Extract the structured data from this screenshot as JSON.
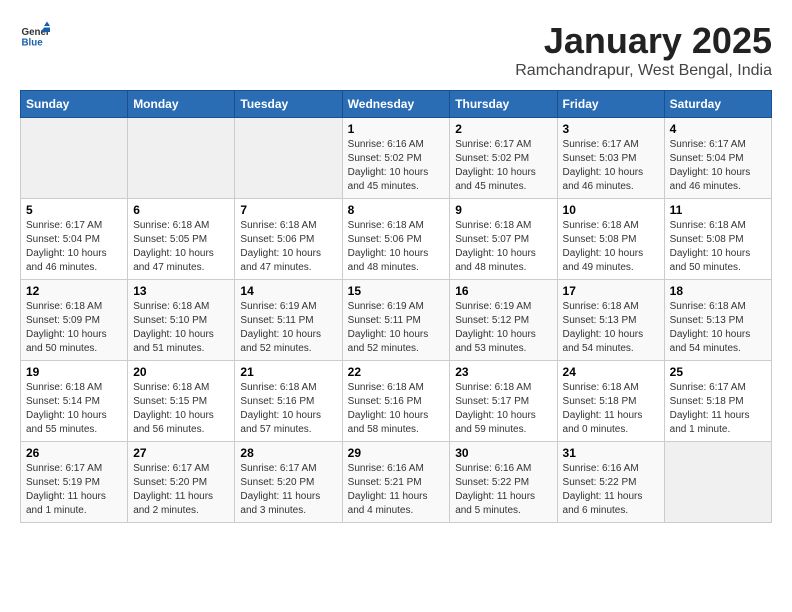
{
  "header": {
    "logo": {
      "general": "General",
      "blue": "Blue"
    },
    "title": "January 2025",
    "subtitle": "Ramchandrapur, West Bengal, India"
  },
  "days_of_week": [
    "Sunday",
    "Monday",
    "Tuesday",
    "Wednesday",
    "Thursday",
    "Friday",
    "Saturday"
  ],
  "weeks": [
    [
      {
        "day": "",
        "sunrise": "",
        "sunset": "",
        "daylight": "",
        "empty": true
      },
      {
        "day": "",
        "sunrise": "",
        "sunset": "",
        "daylight": "",
        "empty": true
      },
      {
        "day": "",
        "sunrise": "",
        "sunset": "",
        "daylight": "",
        "empty": true
      },
      {
        "day": "1",
        "sunrise": "Sunrise: 6:16 AM",
        "sunset": "Sunset: 5:02 PM",
        "daylight": "Daylight: 10 hours and 45 minutes."
      },
      {
        "day": "2",
        "sunrise": "Sunrise: 6:17 AM",
        "sunset": "Sunset: 5:02 PM",
        "daylight": "Daylight: 10 hours and 45 minutes."
      },
      {
        "day": "3",
        "sunrise": "Sunrise: 6:17 AM",
        "sunset": "Sunset: 5:03 PM",
        "daylight": "Daylight: 10 hours and 46 minutes."
      },
      {
        "day": "4",
        "sunrise": "Sunrise: 6:17 AM",
        "sunset": "Sunset: 5:04 PM",
        "daylight": "Daylight: 10 hours and 46 minutes."
      }
    ],
    [
      {
        "day": "5",
        "sunrise": "Sunrise: 6:17 AM",
        "sunset": "Sunset: 5:04 PM",
        "daylight": "Daylight: 10 hours and 46 minutes."
      },
      {
        "day": "6",
        "sunrise": "Sunrise: 6:18 AM",
        "sunset": "Sunset: 5:05 PM",
        "daylight": "Daylight: 10 hours and 47 minutes."
      },
      {
        "day": "7",
        "sunrise": "Sunrise: 6:18 AM",
        "sunset": "Sunset: 5:06 PM",
        "daylight": "Daylight: 10 hours and 47 minutes."
      },
      {
        "day": "8",
        "sunrise": "Sunrise: 6:18 AM",
        "sunset": "Sunset: 5:06 PM",
        "daylight": "Daylight: 10 hours and 48 minutes."
      },
      {
        "day": "9",
        "sunrise": "Sunrise: 6:18 AM",
        "sunset": "Sunset: 5:07 PM",
        "daylight": "Daylight: 10 hours and 48 minutes."
      },
      {
        "day": "10",
        "sunrise": "Sunrise: 6:18 AM",
        "sunset": "Sunset: 5:08 PM",
        "daylight": "Daylight: 10 hours and 49 minutes."
      },
      {
        "day": "11",
        "sunrise": "Sunrise: 6:18 AM",
        "sunset": "Sunset: 5:08 PM",
        "daylight": "Daylight: 10 hours and 50 minutes."
      }
    ],
    [
      {
        "day": "12",
        "sunrise": "Sunrise: 6:18 AM",
        "sunset": "Sunset: 5:09 PM",
        "daylight": "Daylight: 10 hours and 50 minutes."
      },
      {
        "day": "13",
        "sunrise": "Sunrise: 6:18 AM",
        "sunset": "Sunset: 5:10 PM",
        "daylight": "Daylight: 10 hours and 51 minutes."
      },
      {
        "day": "14",
        "sunrise": "Sunrise: 6:19 AM",
        "sunset": "Sunset: 5:11 PM",
        "daylight": "Daylight: 10 hours and 52 minutes."
      },
      {
        "day": "15",
        "sunrise": "Sunrise: 6:19 AM",
        "sunset": "Sunset: 5:11 PM",
        "daylight": "Daylight: 10 hours and 52 minutes."
      },
      {
        "day": "16",
        "sunrise": "Sunrise: 6:19 AM",
        "sunset": "Sunset: 5:12 PM",
        "daylight": "Daylight: 10 hours and 53 minutes."
      },
      {
        "day": "17",
        "sunrise": "Sunrise: 6:18 AM",
        "sunset": "Sunset: 5:13 PM",
        "daylight": "Daylight: 10 hours and 54 minutes."
      },
      {
        "day": "18",
        "sunrise": "Sunrise: 6:18 AM",
        "sunset": "Sunset: 5:13 PM",
        "daylight": "Daylight: 10 hours and 54 minutes."
      }
    ],
    [
      {
        "day": "19",
        "sunrise": "Sunrise: 6:18 AM",
        "sunset": "Sunset: 5:14 PM",
        "daylight": "Daylight: 10 hours and 55 minutes."
      },
      {
        "day": "20",
        "sunrise": "Sunrise: 6:18 AM",
        "sunset": "Sunset: 5:15 PM",
        "daylight": "Daylight: 10 hours and 56 minutes."
      },
      {
        "day": "21",
        "sunrise": "Sunrise: 6:18 AM",
        "sunset": "Sunset: 5:16 PM",
        "daylight": "Daylight: 10 hours and 57 minutes."
      },
      {
        "day": "22",
        "sunrise": "Sunrise: 6:18 AM",
        "sunset": "Sunset: 5:16 PM",
        "daylight": "Daylight: 10 hours and 58 minutes."
      },
      {
        "day": "23",
        "sunrise": "Sunrise: 6:18 AM",
        "sunset": "Sunset: 5:17 PM",
        "daylight": "Daylight: 10 hours and 59 minutes."
      },
      {
        "day": "24",
        "sunrise": "Sunrise: 6:18 AM",
        "sunset": "Sunset: 5:18 PM",
        "daylight": "Daylight: 11 hours and 0 minutes."
      },
      {
        "day": "25",
        "sunrise": "Sunrise: 6:17 AM",
        "sunset": "Sunset: 5:18 PM",
        "daylight": "Daylight: 11 hours and 1 minute."
      }
    ],
    [
      {
        "day": "26",
        "sunrise": "Sunrise: 6:17 AM",
        "sunset": "Sunset: 5:19 PM",
        "daylight": "Daylight: 11 hours and 1 minute."
      },
      {
        "day": "27",
        "sunrise": "Sunrise: 6:17 AM",
        "sunset": "Sunset: 5:20 PM",
        "daylight": "Daylight: 11 hours and 2 minutes."
      },
      {
        "day": "28",
        "sunrise": "Sunrise: 6:17 AM",
        "sunset": "Sunset: 5:20 PM",
        "daylight": "Daylight: 11 hours and 3 minutes."
      },
      {
        "day": "29",
        "sunrise": "Sunrise: 6:16 AM",
        "sunset": "Sunset: 5:21 PM",
        "daylight": "Daylight: 11 hours and 4 minutes."
      },
      {
        "day": "30",
        "sunrise": "Sunrise: 6:16 AM",
        "sunset": "Sunset: 5:22 PM",
        "daylight": "Daylight: 11 hours and 5 minutes."
      },
      {
        "day": "31",
        "sunrise": "Sunrise: 6:16 AM",
        "sunset": "Sunset: 5:22 PM",
        "daylight": "Daylight: 11 hours and 6 minutes."
      },
      {
        "day": "",
        "sunrise": "",
        "sunset": "",
        "daylight": "",
        "empty": true
      }
    ]
  ]
}
